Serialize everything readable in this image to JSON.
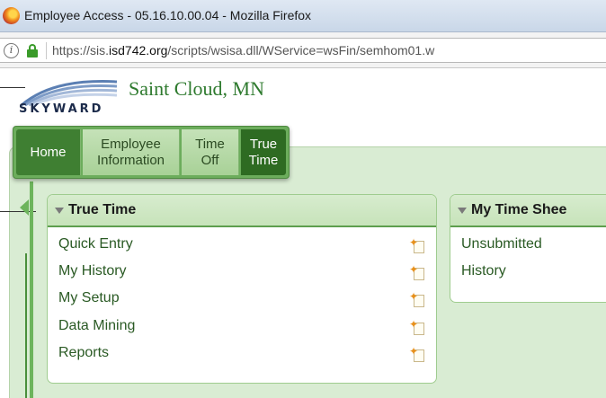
{
  "window": {
    "title": "Employee Access - 05.16.10.00.04 - Mozilla Firefox",
    "icon": "firefox-icon"
  },
  "address_bar": {
    "url_prefix": "https://sis.",
    "url_domain": "isd742.org",
    "url_path": "/scripts/wsisa.dll/WService=wsFin/semhom01.w",
    "icons": [
      "info-icon",
      "lock-icon"
    ]
  },
  "header": {
    "logo_text": "SKYWARD",
    "district_name": "Saint Cloud, MN"
  },
  "nav": {
    "tabs": [
      {
        "line1": "Home",
        "line2": ""
      },
      {
        "line1": "Employee",
        "line2": "Information"
      },
      {
        "line1": "Time",
        "line2": "Off"
      },
      {
        "line1": "True",
        "line2": "Time"
      }
    ],
    "active_tab": "True Time"
  },
  "widgets": {
    "true_time": {
      "title": "True Time",
      "items": [
        "Quick Entry",
        "My History",
        "My Setup",
        "Data Mining",
        "Reports"
      ]
    },
    "my_time_sheet": {
      "title": "My Time Shee",
      "items": [
        "Unsubmitted",
        "History"
      ]
    }
  },
  "colors": {
    "brand_green": "#2e7a2e",
    "nav_active": "#2e6b22",
    "panel_bg": "#d9ecd3",
    "link_green": "#2a5a24"
  }
}
